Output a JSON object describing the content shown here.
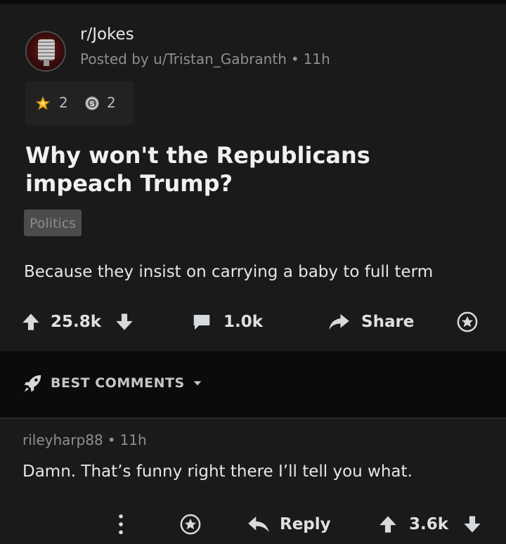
{
  "post": {
    "subreddit": "r/Jokes",
    "posted_by": "Posted by u/Tristan_Gabranth",
    "separator": "•",
    "age": "11h",
    "awards": [
      {
        "icon": "gold-award-icon",
        "count": "2"
      },
      {
        "icon": "silver-award-icon",
        "count": "2"
      }
    ],
    "title": "Why won't the Republicans impeach Trump?",
    "flair": "Politics",
    "body": "Because they insist on carrying a baby to full term",
    "score": "25.8k",
    "comments": "1.0k",
    "share_label": "Share"
  },
  "sort": {
    "label": "BEST COMMENTS"
  },
  "comment": {
    "author": "rileyharp88",
    "separator": "•",
    "age": "11h",
    "body": "Damn. That’s funny right there I’ll tell you what.",
    "reply_label": "Reply",
    "score": "3.6k"
  },
  "colors": {
    "background": "#1a1a1b",
    "sort_bar": "#0b0b0b",
    "text": "#d7dadc",
    "muted": "#8d8f91",
    "award_gold": "#f2b21a"
  }
}
